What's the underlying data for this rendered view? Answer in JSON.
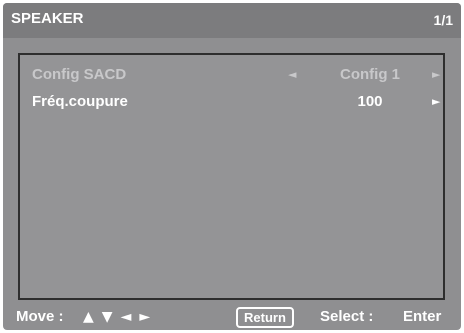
{
  "header": {
    "title": "SPEAKER",
    "page_indicator": "1/1"
  },
  "menu": {
    "items": [
      {
        "label": "Config SACD",
        "value": "Config 1",
        "left_arrow": "◄",
        "right_arrow": "►",
        "state": "disabled"
      },
      {
        "label": "Fréq.coupure",
        "value": "100",
        "right_arrow": "►",
        "state": "enabled"
      }
    ]
  },
  "footer": {
    "move_label": "Move :",
    "nav_up": "▲",
    "nav_down": "▼",
    "nav_left": "◄",
    "nav_right": "►",
    "return_label": "Return",
    "select_label": "Select :",
    "enter_label": "Enter"
  },
  "colors": {
    "background": "#8f8f91",
    "header": "#7c7c7e",
    "text": "#ffffff",
    "disabled_text": "#c8c8ca"
  }
}
